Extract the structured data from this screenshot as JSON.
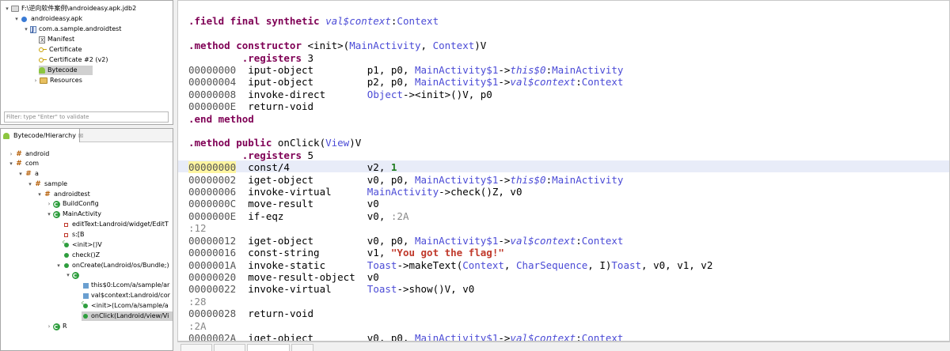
{
  "project": {
    "root": "F:\\逆向软件案例\\androideasy.apk.jdb2",
    "apk": "androideasy.apk",
    "package": "com.a.sample.androidtest",
    "items": [
      "Manifest",
      "Certificate",
      "Certificate #2 (v2)",
      "Bytecode",
      "Resources"
    ],
    "filter_placeholder": "Filter: type \"Enter\" to validate"
  },
  "hierarchy": {
    "tab_title": "Bytecode/Hierarchy",
    "close_glyph": "☒",
    "nodes": [
      "android",
      "com",
      "a",
      "sample",
      "androidtest",
      "BuildConfig",
      "MainActivity",
      "editText:Landroid/widget/EditT",
      "s:[B",
      "<init>()V",
      "check()Z",
      "onCreate(Landroid/os/Bundle;)",
      "this$0:Lcom/a/sample/ar",
      "val$context:Landroid/cor",
      "<init>(Lcom/a/sample/a",
      "onClick(Landroid/view/Vi",
      "R"
    ]
  },
  "code": {
    "l1": {
      "a": ".field final synthetic ",
      "b": "val$context",
      "c": ":",
      "d": "Context"
    },
    "l3": {
      "a": ".method constructor ",
      "b": "<init>(",
      "c": "MainActivity",
      "d": ", ",
      "e": "Context",
      "f": ")V"
    },
    "l4": {
      "a": "         ",
      "b": ".registers",
      "c": " 3"
    },
    "l5": {
      "addr": "00000000",
      "op": "  iput-object         p1, p0, ",
      "t1": "MainActivity$1",
      "s": "->",
      "f": "this$0",
      "c": ":",
      "t2": "MainActivity"
    },
    "l6": {
      "addr": "00000004",
      "op": "  iput-object         p2, p0, ",
      "t1": "MainActivity$1",
      "s": "->",
      "f": "val$context",
      "c": ":",
      "t2": "Context"
    },
    "l7": {
      "addr": "00000008",
      "op": "  invoke-direct       ",
      "t1": "Object",
      "s": "-><init>()V, p0"
    },
    "l8": {
      "addr": "0000000E",
      "op": "  return-void"
    },
    "l9": {
      "a": ".end method"
    },
    "l11": {
      "a": ".method public ",
      "b": "onClick(",
      "c": "View",
      "d": ")V"
    },
    "l12": {
      "a": "         ",
      "b": ".registers",
      "c": " 5"
    },
    "l13": {
      "addr": "00000000",
      "op": "  const/4             v2, ",
      "n": "1"
    },
    "l14": {
      "addr": "00000002",
      "op": "  iget-object         v0, p0, ",
      "t1": "MainActivity$1",
      "s": "->",
      "f": "this$0",
      "c": ":",
      "t2": "MainActivity"
    },
    "l15": {
      "addr": "00000006",
      "op": "  invoke-virtual      ",
      "t1": "MainActivity",
      "s": "->check()Z, v0"
    },
    "l16": {
      "addr": "0000000C",
      "op": "  move-result         v0"
    },
    "l17": {
      "addr": "0000000E",
      "op": "  if-eqz              v0, ",
      "l": ":2A"
    },
    "l18": {
      "l": ":12"
    },
    "l19": {
      "addr": "00000012",
      "op": "  iget-object         v0, p0, ",
      "t1": "MainActivity$1",
      "s": "->",
      "f": "val$context",
      "c": ":",
      "t2": "Context"
    },
    "l20": {
      "addr": "00000016",
      "op": "  const-string        v1, ",
      "str": "\"You got the flag!\""
    },
    "l21": {
      "addr": "0000001A",
      "op": "  invoke-static       ",
      "t1": "Toast",
      "s1": "->makeText(",
      "t2": "Context",
      "s2": ", ",
      "t3": "CharSequence",
      "s3": ", I)",
      "t4": "Toast",
      "s4": ", v0, v1, v2"
    },
    "l22": {
      "addr": "00000020",
      "op": "  move-result-object  v0"
    },
    "l23": {
      "addr": "00000022",
      "op": "  invoke-virtual      ",
      "t1": "Toast",
      "s": "->show()V, v0"
    },
    "l24": {
      "l": ":28"
    },
    "l25": {
      "addr": "00000028",
      "op": "  return-void"
    },
    "l26": {
      "l": ":2A"
    },
    "l27": {
      "addr": "0000002A",
      "op": "  iget-object         v0, p0, ",
      "t1": "MainActivity$1",
      "s": "->",
      "f": "val$context",
      "c": ":",
      "t2": "Context"
    }
  },
  "colors": {
    "directive": "#7f0055",
    "type": "#4b4bd6",
    "string": "#c0392b",
    "number": "#1c7a1c",
    "label": "#888888",
    "current_line": "#e8ecf8",
    "address_highlight": "#fef5a0"
  }
}
